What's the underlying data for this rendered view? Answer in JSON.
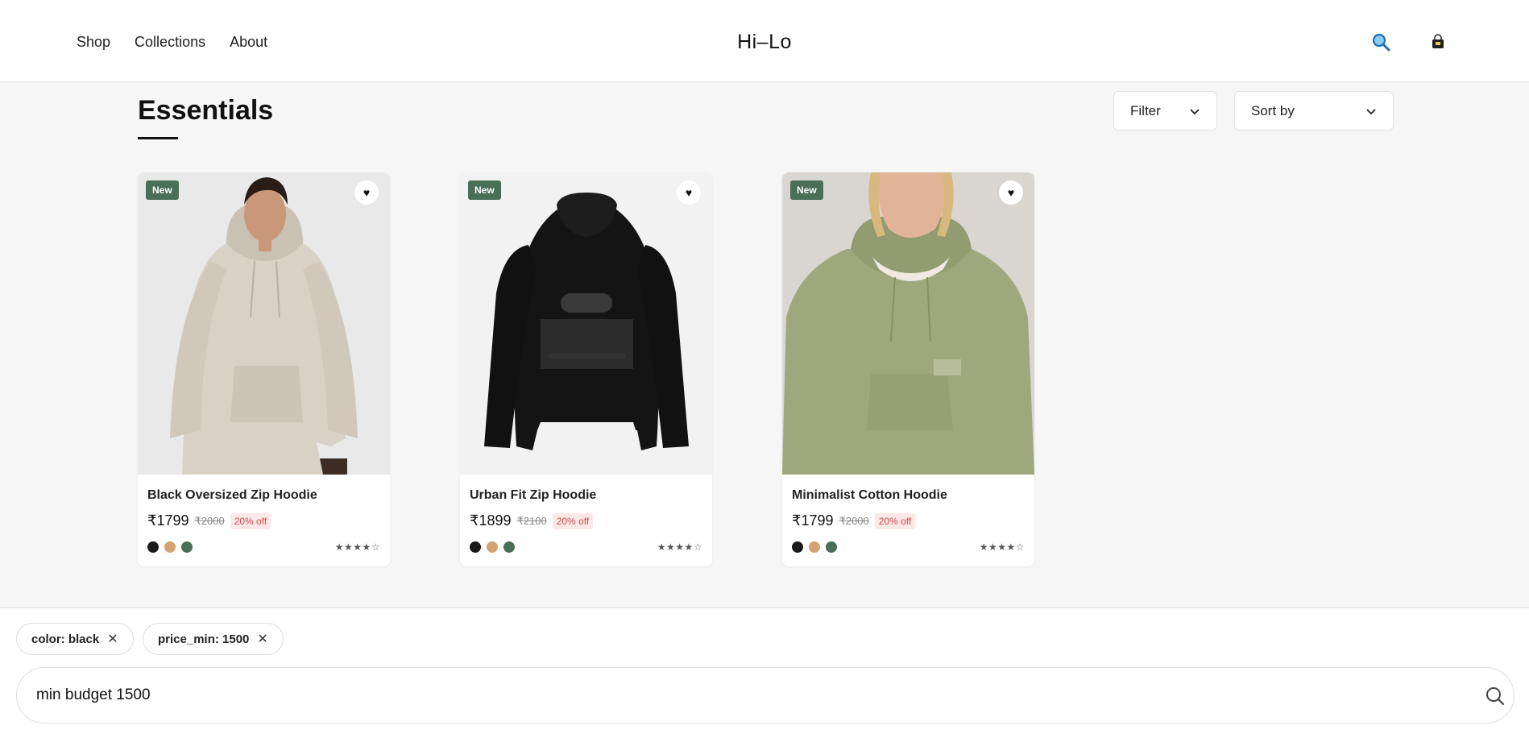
{
  "header": {
    "nav": [
      {
        "label": "Shop"
      },
      {
        "label": "Collections"
      },
      {
        "label": "About"
      }
    ],
    "logo": "Hi–Lo",
    "search_icon": "search-icon",
    "cart_icon": "shopping-bag-icon"
  },
  "page": {
    "title": "Essentials",
    "filter_label": "Filter",
    "sort_label": "Sort by"
  },
  "products": [
    {
      "badge": "New",
      "name": "Black Oversized Zip Hoodie",
      "price": "₹1799",
      "old_price": "₹2000",
      "discount": "20% off",
      "rating_text": "★★★★☆",
      "image_desc": "beige-hoodie-model"
    },
    {
      "badge": "New",
      "name": "Urban Fit Zip Hoodie",
      "price": "₹1899",
      "old_price": "₹2100",
      "discount": "20% off",
      "rating_text": "★★★★☆",
      "image_desc": "black-harlem-hoodie"
    },
    {
      "badge": "New",
      "name": "Minimalist Cotton Hoodie",
      "price": "₹1799",
      "old_price": "₹2000",
      "discount": "20% off",
      "rating_text": "★★★★☆",
      "image_desc": "olive-hoodie-model"
    }
  ],
  "swatch_colors": [
    "#1a1a1a",
    "#d4a373",
    "#4a6f57"
  ],
  "colors": {
    "badge": "#4a6f57",
    "discount_text": "#d24b4b",
    "discount_bg": "#fde8e8"
  },
  "filters": [
    {
      "label": "color: black"
    },
    {
      "label": "price_min: 1500"
    }
  ],
  "chat": {
    "query_value": "min budget 1500"
  }
}
